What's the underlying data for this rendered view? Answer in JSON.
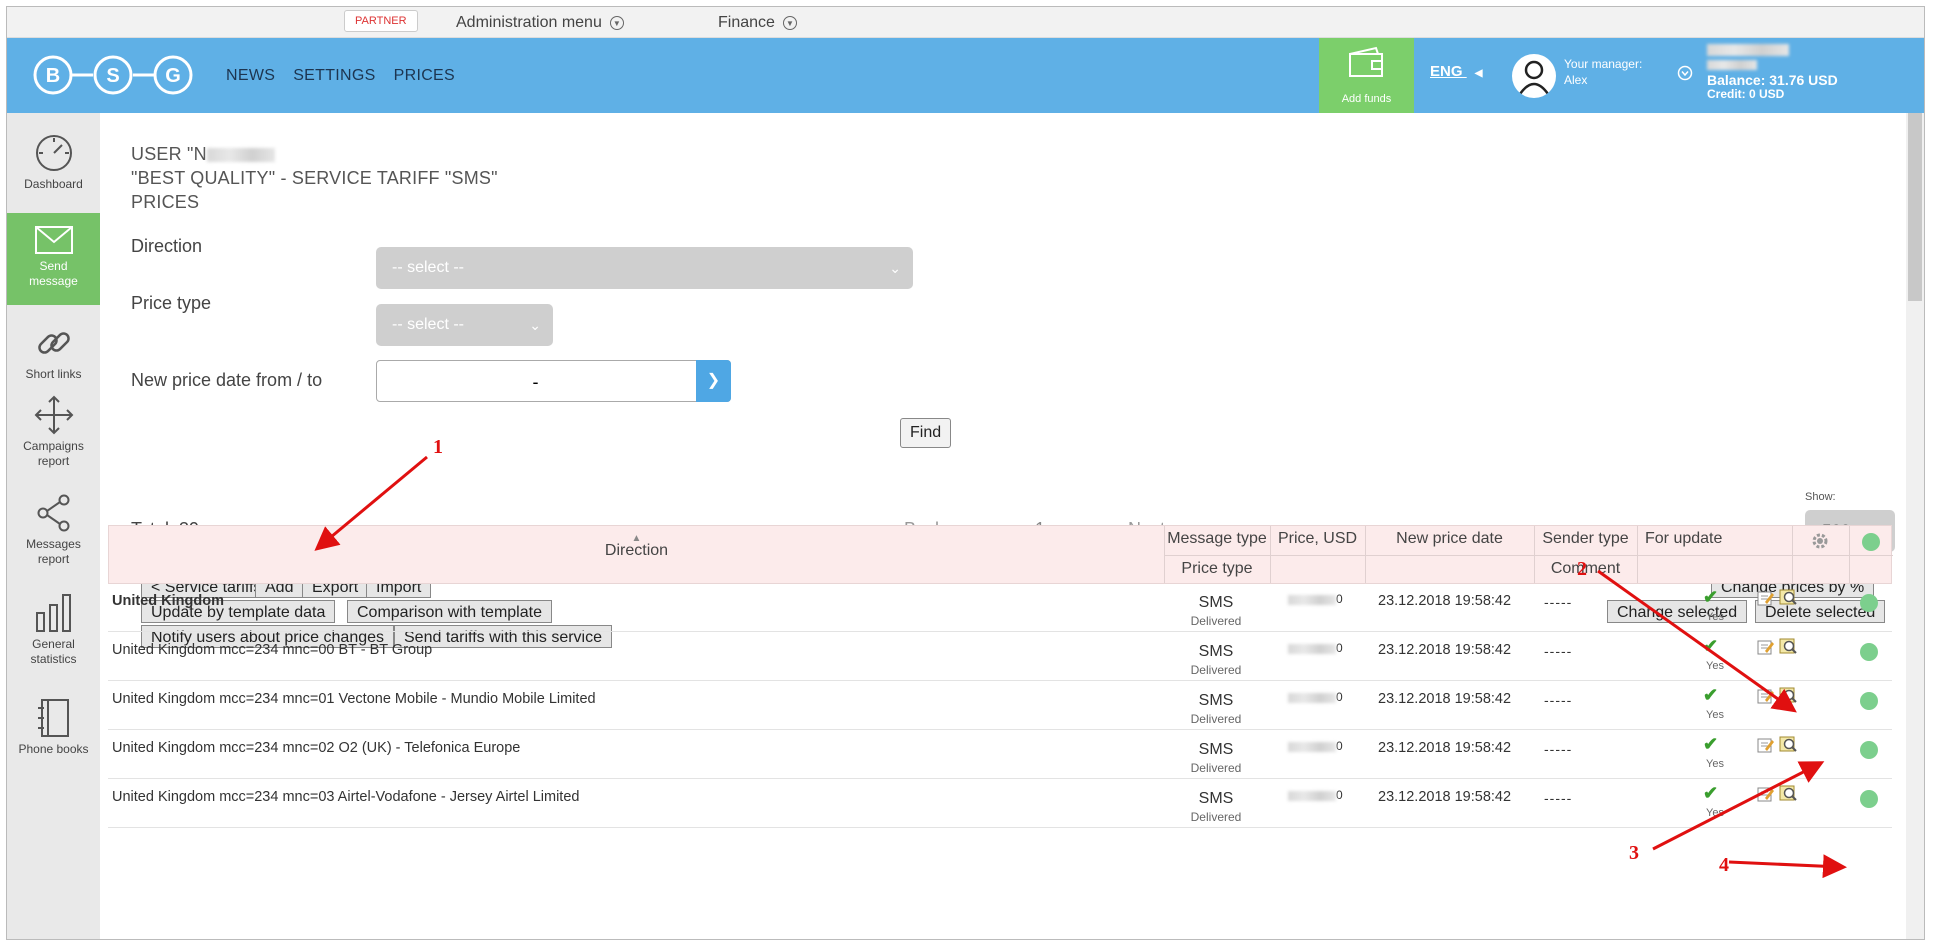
{
  "adminbar": {
    "partner_label": "PARTNER",
    "admin_menu": "Administration menu",
    "finance": "Finance"
  },
  "header": {
    "logo_letters": [
      "B",
      "S",
      "G"
    ],
    "nav": [
      "NEWS",
      "SETTINGS",
      "PRICES"
    ],
    "add_funds": "Add funds",
    "lang": "ENG",
    "manager_label": "Your manager:",
    "manager_name": "Alex",
    "balance": "Balance: 31.76 USD",
    "credit": "Credit: 0 USD",
    "accent_color": "#5fb0e6",
    "green_color": "#7ccf6b"
  },
  "sidebar": {
    "items": [
      {
        "label": "Dashboard",
        "icon": "speedometer-icon"
      },
      {
        "label": "Send message",
        "icon": "envelope-icon"
      },
      {
        "label": "Short links",
        "icon": "link-icon"
      },
      {
        "label": "Campaigns report",
        "icon": "move-arrows-icon"
      },
      {
        "label": "Messages report",
        "icon": "share-icon"
      },
      {
        "label": "General statistics",
        "icon": "bar-chart-icon"
      },
      {
        "label": "Phone books",
        "icon": "notebook-icon"
      }
    ]
  },
  "page": {
    "title_user": "USER \"N",
    "title_service": "\"BEST QUALITY\" - SERVICE TARIFF \"SMS\"",
    "title_prices": "PRICES"
  },
  "filters": {
    "direction_label": "Direction",
    "direction_value": "-- select --",
    "price_type_label": "Price type",
    "price_type_value": "-- select --",
    "date_label": "New price date from / to",
    "date_value": "-",
    "find_button": "Find"
  },
  "pagination": {
    "total": "Total: 39",
    "back": "‹ Back",
    "page": "1",
    "next": "Next ›",
    "show_label": "Show:",
    "show_value": "500"
  },
  "toolbar": {
    "service_tariffs": "< Service tariffs",
    "add": "Add",
    "export": "Export",
    "import": "Import",
    "update_template": "Update by template data",
    "comparison": "Comparison with template",
    "notify": "Notify users about price changes",
    "send_tariffs": "Send tariffs with this service",
    "change_prices_pct": "Change prices by %",
    "change_selected": "Change selected",
    "delete_selected": "Delete selected"
  },
  "table": {
    "headers": {
      "direction": "Direction",
      "message_type": "Message type",
      "price_type": "Price type",
      "price": "Price, USD",
      "new_price_date": "New price date",
      "sender_type": "Sender type",
      "comment": "Comment",
      "for_update": "For update"
    },
    "rows": [
      {
        "direction": "United Kingdom",
        "bold": true,
        "message_type": "SMS",
        "price_type": "Delivered",
        "price_tail": "0",
        "date": "23.12.2018 19:58:42",
        "sender": "-----",
        "for_update": "Yes"
      },
      {
        "direction": "United Kingdom mcc=234 mnc=00 BT - BT Group",
        "bold": false,
        "message_type": "SMS",
        "price_type": "Delivered",
        "price_tail": "0",
        "date": "23.12.2018 19:58:42",
        "sender": "-----",
        "for_update": "Yes"
      },
      {
        "direction": "United Kingdom mcc=234 mnc=01 Vectone Mobile - Mundio Mobile Limited",
        "bold": false,
        "message_type": "SMS",
        "price_type": "Delivered",
        "price_tail": "0",
        "date": "23.12.2018 19:58:42",
        "sender": "-----",
        "for_update": "Yes"
      },
      {
        "direction": "United Kingdom mcc=234 mnc=02 O2 (UK) - Telefonica Europe",
        "bold": false,
        "message_type": "SMS",
        "price_type": "Delivered",
        "price_tail": "0",
        "date": "23.12.2018 19:58:42",
        "sender": "-----",
        "for_update": "Yes"
      },
      {
        "direction": "United Kingdom mcc=234 mnc=03 Airtel-Vodafone - Jersey Airtel Limited",
        "bold": false,
        "message_type": "SMS",
        "price_type": "Delivered",
        "price_tail": "0",
        "date": "23.12.2018 19:58:42",
        "sender": "-----",
        "for_update": "Yes"
      }
    ]
  },
  "annotations": [
    "1",
    "2",
    "3",
    "4"
  ]
}
